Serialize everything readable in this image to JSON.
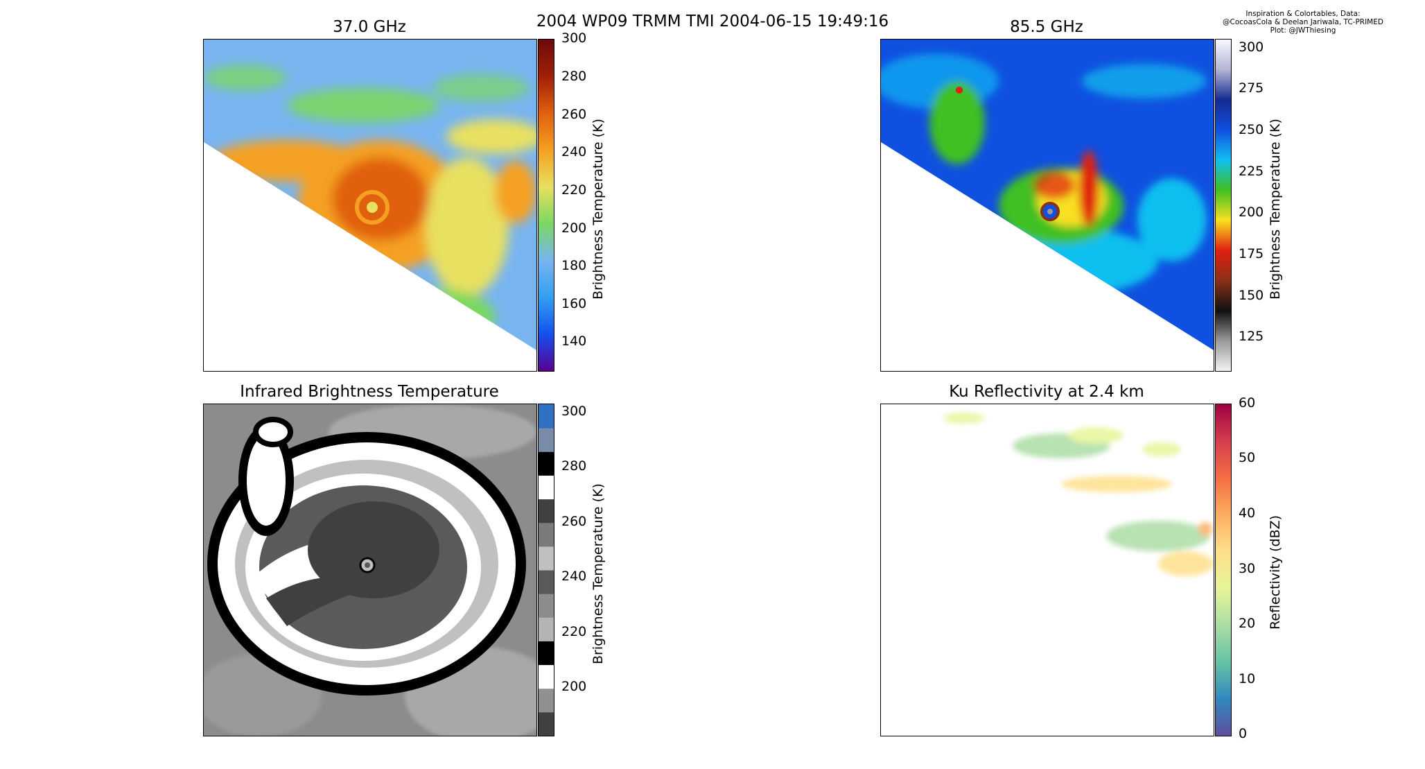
{
  "figure": {
    "title": "2004 WP09 TRMM TMI 2004-06-15 19:49:16",
    "credits": [
      "Inspiration & Colortables, Data:",
      "@CocoasCola & Deelan Jariwala, TC-PRIMED",
      "Plot: @JWThiesing"
    ]
  },
  "chart_data": [
    {
      "type": "heatmap",
      "title": "37.0 GHz",
      "colorbar": {
        "label": "Brightness Temperature (K)",
        "range": [
          125,
          300
        ],
        "ticks": [
          "140",
          "160",
          "180",
          "200",
          "220",
          "240",
          "260",
          "280",
          "300"
        ],
        "colors": [
          "#5a0090",
          "#1450f0",
          "#32a0f0",
          "#78b4f0",
          "#7ad860",
          "#e8e060",
          "#f5a020",
          "#e06010",
          "#a02008",
          "#6e0a0a"
        ]
      }
    },
    {
      "type": "heatmap",
      "title": "85.5 GHz",
      "colorbar": {
        "label": "Brightness Temperature (K)",
        "range": [
          105,
          305
        ],
        "ticks": [
          "125",
          "150",
          "175",
          "200",
          "225",
          "250",
          "275",
          "300"
        ],
        "colors": [
          "#f2f2f2",
          "#9a9a9a",
          "#101010",
          "#8a3018",
          "#e02010",
          "#f8e020",
          "#40c020",
          "#10c0f0",
          "#1050e0",
          "#142a90",
          "#b4b4d4",
          "#f8f8ff"
        ]
      }
    },
    {
      "type": "heatmap",
      "title": "Infrared Brightness Temperature",
      "colorbar": {
        "label": "Brightness Temperature (K)",
        "range": [
          183,
          305
        ],
        "ticks": [
          "200",
          "220",
          "240",
          "260",
          "280",
          "300"
        ],
        "colors": [
          "#404040",
          "#909090",
          "#ffffff",
          "#000000",
          "#b4b4b4",
          "#8c8c8c",
          "#5a5a5a",
          "#c0c0c0",
          "#7a7a7a",
          "#404040",
          "#ffffff",
          "#000000",
          "#7a8ca8",
          "#3070c0"
        ]
      }
    },
    {
      "type": "heatmap",
      "title": "Ku Reflectivity at 2.4 km",
      "colorbar": {
        "label": "Reflectivity (dBZ)",
        "range": [
          0,
          60
        ],
        "ticks": [
          "0",
          "10",
          "20",
          "30",
          "40",
          "50",
          "60"
        ],
        "colors": [
          "#5e4fa2",
          "#3288bd",
          "#66c2a5",
          "#abdda4",
          "#e6f598",
          "#fee08b",
          "#fdae61",
          "#f46d43",
          "#d53e4f",
          "#9e0142"
        ]
      }
    }
  ]
}
